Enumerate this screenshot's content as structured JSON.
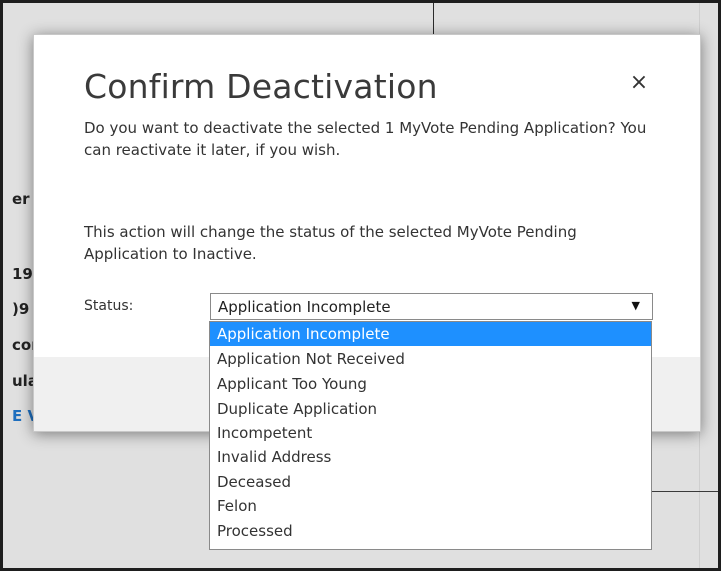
{
  "background": {
    "fragments": [
      "er",
      "19",
      ")9",
      "cor",
      "ula",
      "E V"
    ]
  },
  "dialog": {
    "title": "Confirm Deactivation",
    "close_symbol": "×",
    "message_1": "Do you want to deactivate the selected 1 MyVote Pending Application? You can reactivate it later, if you wish.",
    "message_2": "This action will change the status of the selected MyVote Pending Application to Inactive.",
    "status_label": "Status:",
    "status_value": "Application Incomplete",
    "arrow_symbol": "▼"
  },
  "status_options": [
    "Application Incomplete",
    "Application Not Received",
    "Applicant Too Young",
    "Duplicate Application",
    "Incompetent",
    "Invalid Address",
    "Deceased",
    "Felon",
    "Processed"
  ],
  "colors": {
    "selected_option": "#1e90ff",
    "link": "#1e6fbf"
  }
}
